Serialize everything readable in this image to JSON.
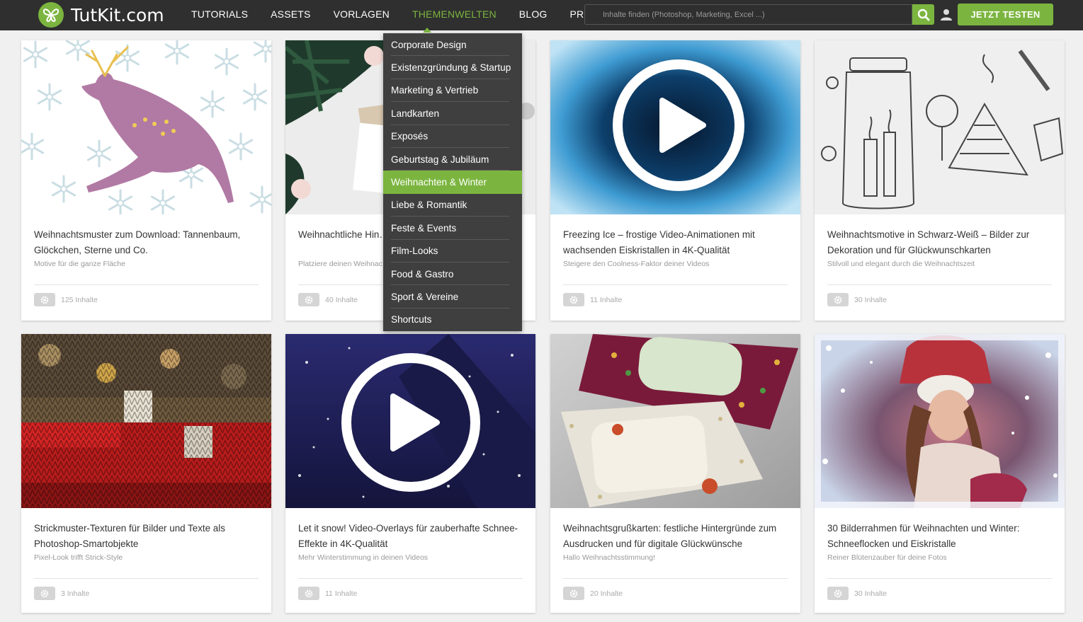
{
  "header": {
    "logo_text": "TutKit.com",
    "nav": [
      "TUTORIALS",
      "ASSETS",
      "VORLAGEN",
      "THEMENWELTEN",
      "BLOG",
      "PREISE"
    ],
    "active_nav": "THEMENWELTEN",
    "search_placeholder": "Inhalte finden (Photoshop, Marketing, Excel ...)",
    "cta_label": "JETZT TESTEN",
    "accent_color": "#7bb53f"
  },
  "dropdown": {
    "items": [
      "Corporate Design",
      "Existenzgründung & Startup",
      "Marketing & Vertrieb",
      "Landkarten",
      "Exposés",
      "Geburtstag & Jubiläum",
      "Weihnachten & Winter",
      "Liebe & Romantik",
      "Feste & Events",
      "Film-Looks",
      "Food & Gastro",
      "Sport & Vereine",
      "Shortcuts"
    ],
    "active_item": "Weihnachten & Winter"
  },
  "cards": [
    {
      "title": "Weihnachtsmuster zum Download: Tannenbaum, Glöckchen, Sterne und Co.",
      "subtitle": "Motive für die ganze Fläche",
      "count": "125 Inhalte"
    },
    {
      "title": "Weihnachtliche Hin… Photoshop-Mockup…",
      "subtitle": "Platziere deinen Weihnac…",
      "count": "40 Inhalte"
    },
    {
      "title": "Freezing Ice – frostige Video-Animationen mit wachsenden Eiskristallen in 4K-Qualität",
      "subtitle": "Steigere den Coolness-Faktor deiner Videos",
      "count": "11 Inhalte"
    },
    {
      "title": "Weihnachtsmotive in Schwarz-Weiß – Bilder zur Dekoration und für Glückwunschkarten",
      "subtitle": "Stilvoll und elegant durch die Weihnachtszeit",
      "count": "30 Inhalte"
    },
    {
      "title": "Strickmuster-Texturen für Bilder und Texte als Photoshop-Smartobjekte",
      "subtitle": "Pixel-Look trifft Strick-Style",
      "count": "3 Inhalte"
    },
    {
      "title": "Let it snow! Video-Overlays für zauberhafte Schnee-Effekte in 4K-Qualität",
      "subtitle": "Mehr Winterstimmung in deinen Videos",
      "count": "11 Inhalte"
    },
    {
      "title": "Weihnachtsgrußkarten: festliche Hintergründe zum Ausdrucken und für digitale Glückwünsche",
      "subtitle": "Hallo Weihnachtsstimmung!",
      "count": "20 Inhalte"
    },
    {
      "title": "30 Bilderrahmen für Weihnachten und Winter: Schneeflocken und Eiskristalle",
      "subtitle": "Reiner Blütenzauber für deine Fotos",
      "count": "30 Inhalte"
    }
  ]
}
